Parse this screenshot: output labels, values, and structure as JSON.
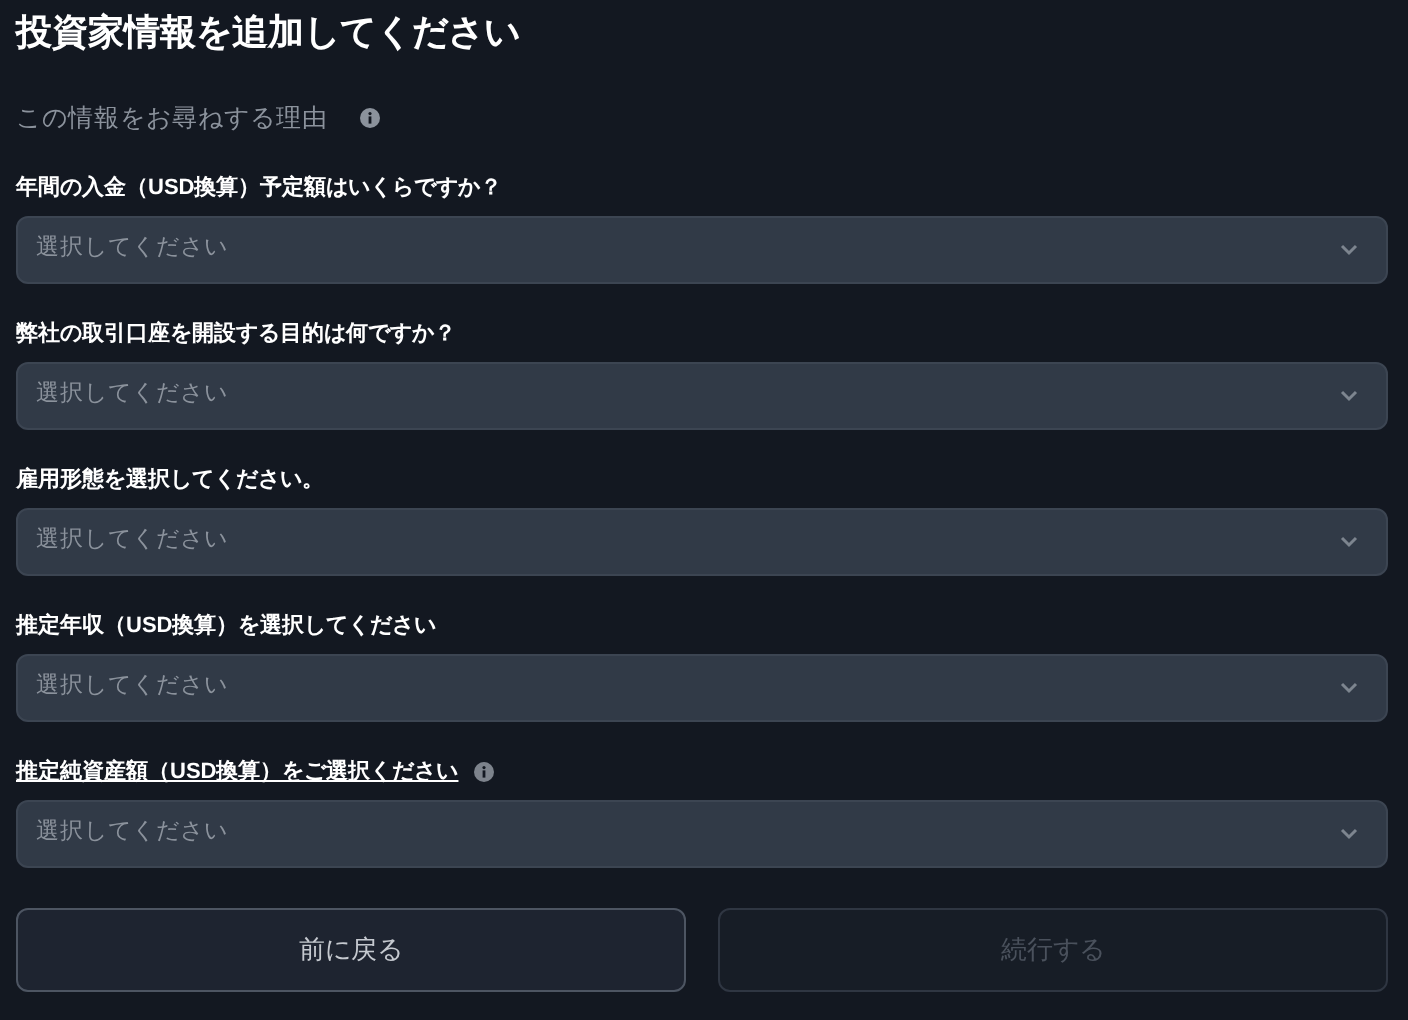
{
  "title": "投資家情報を追加してください",
  "reason": {
    "text": "この情報をお尋ねする理由",
    "info_icon": true
  },
  "questions": [
    {
      "label": "年間の入金（USD換算）予定額はいくらですか？",
      "underlined": false,
      "info_icon": false,
      "placeholder": "選択してください"
    },
    {
      "label": "弊社の取引口座を開設する目的は何ですか？",
      "underlined": false,
      "info_icon": false,
      "placeholder": "選択してください"
    },
    {
      "label": "雇用形態を選択してください。",
      "underlined": false,
      "info_icon": false,
      "placeholder": "選択してください"
    },
    {
      "label": "推定年収（USD換算）を選択してください",
      "underlined": false,
      "info_icon": false,
      "placeholder": "選択してください"
    },
    {
      "label": "推定純資産額（USD換算）をご選択ください",
      "underlined": true,
      "info_icon": true,
      "placeholder": "選択してください"
    }
  ],
  "buttons": [
    {
      "label": "前に戻る",
      "disabled": false
    },
    {
      "label": "続行する",
      "disabled": true
    }
  ]
}
